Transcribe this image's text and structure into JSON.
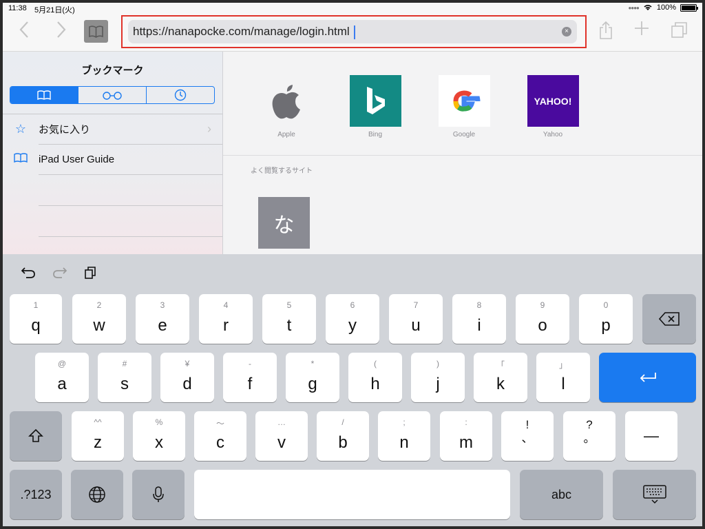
{
  "status": {
    "time": "11:38",
    "date": "5月21日(火)",
    "battery": "100%"
  },
  "toolbar": {
    "back_icon": "chevron-left",
    "forward_icon": "chevron-right",
    "url": "https://nanapocke.com/manage/login.html",
    "clear_icon": "×"
  },
  "sidebar": {
    "title": "ブックマーク",
    "tabs": [
      {
        "icon": "book-icon"
      },
      {
        "icon": "glasses-icon"
      },
      {
        "icon": "clock-icon"
      }
    ],
    "items": [
      {
        "label": "お気に入り",
        "icon": "star-icon"
      },
      {
        "label": "iPad User Guide",
        "icon": "book-icon"
      }
    ]
  },
  "favorites": [
    {
      "label": "Apple"
    },
    {
      "label": "Bing"
    },
    {
      "label": "Google"
    },
    {
      "label": "Yahoo",
      "tile_text": "YAHOO!"
    }
  ],
  "frequent": {
    "title": "よく閲覧するサイト",
    "tile_char": "な"
  },
  "keyboard": {
    "row1": [
      {
        "hint": "1",
        "key": "q"
      },
      {
        "hint": "2",
        "key": "w"
      },
      {
        "hint": "3",
        "key": "e"
      },
      {
        "hint": "4",
        "key": "r"
      },
      {
        "hint": "5",
        "key": "t"
      },
      {
        "hint": "6",
        "key": "y"
      },
      {
        "hint": "7",
        "key": "u"
      },
      {
        "hint": "8",
        "key": "i"
      },
      {
        "hint": "9",
        "key": "o"
      },
      {
        "hint": "0",
        "key": "p"
      }
    ],
    "row2": [
      {
        "hint": "@",
        "key": "a"
      },
      {
        "hint": "#",
        "key": "s"
      },
      {
        "hint": "¥",
        "key": "d"
      },
      {
        "hint": "-",
        "key": "f"
      },
      {
        "hint": "*",
        "key": "g"
      },
      {
        "hint": "(",
        "key": "h"
      },
      {
        "hint": ")",
        "key": "j"
      },
      {
        "hint": "「",
        "key": "k"
      },
      {
        "hint": "」",
        "key": "l"
      }
    ],
    "row3": [
      {
        "hint": "^^",
        "key": "z"
      },
      {
        "hint": "%",
        "key": "x"
      },
      {
        "hint": "〜",
        "key": "c"
      },
      {
        "hint": "…",
        "key": "v"
      },
      {
        "hint": "/",
        "key": "b"
      },
      {
        "hint": ";",
        "key": "n"
      },
      {
        "hint": ":",
        "key": "m"
      }
    ],
    "punct1": {
      "top": "!",
      "bottom": "、"
    },
    "punct2": {
      "top": "?",
      "bottom": "。"
    },
    "dash": "—",
    "numbers_label": ".?123",
    "abc_label": "abc"
  }
}
